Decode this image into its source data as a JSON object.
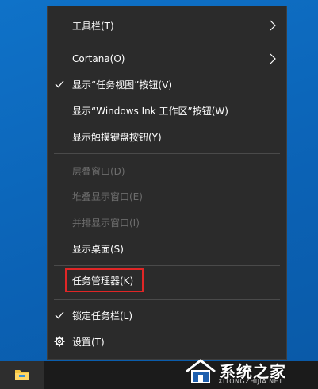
{
  "menu": {
    "items": [
      {
        "label": "工具栏(T)",
        "submenu": true
      },
      {
        "label": "Cortana(O)",
        "submenu": true
      },
      {
        "label": "显示“任务视图”按钮(V)",
        "checked": true
      },
      {
        "label": "显示“Windows Ink 工作区”按钮(W)"
      },
      {
        "label": "显示触摸键盘按钮(Y)"
      },
      {
        "label": "层叠窗口(D)",
        "disabled": true
      },
      {
        "label": "堆叠显示窗口(E)",
        "disabled": true
      },
      {
        "label": "并排显示窗口(I)",
        "disabled": true
      },
      {
        "label": "显示桌面(S)"
      },
      {
        "label": "任务管理器(K)",
        "highlighted": true
      },
      {
        "label": "锁定任务栏(L)",
        "checked": true
      },
      {
        "label": "设置(T)",
        "icon": "gear-icon"
      }
    ]
  },
  "watermark": {
    "text": "系统之家",
    "sub": "XITONGZHIJIA.NET"
  },
  "colors": {
    "menu_bg": "#2b2b2b",
    "highlight_border": "#e02626",
    "desktop": "#0e6dc2"
  }
}
